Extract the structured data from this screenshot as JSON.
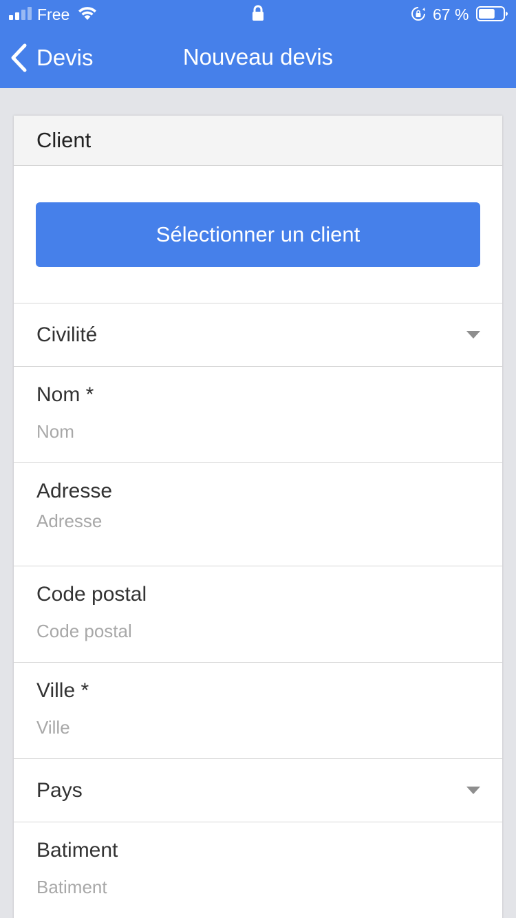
{
  "status_bar": {
    "carrier": "Free",
    "battery_percent": "67 %",
    "battery_level": 0.67,
    "icons": [
      "signal-icon",
      "wifi-icon",
      "lock-icon",
      "rotation-lock-icon",
      "battery-icon"
    ]
  },
  "nav": {
    "back_label": "Devis",
    "title": "Nouveau devis",
    "back_icon": "chevron-left-icon"
  },
  "colors": {
    "accent": "#4680ea",
    "background": "#e3e4e8",
    "placeholder": "#a8a8a8"
  },
  "card": {
    "header": "Client",
    "select_client_label": "Sélectionner un client",
    "fields": {
      "civilite": {
        "label": "Civilité",
        "icon": "dropdown-caret-icon"
      },
      "nom": {
        "label": "Nom *",
        "placeholder": "Nom",
        "value": ""
      },
      "adresse": {
        "label": "Adresse",
        "placeholder": "Adresse",
        "value": ""
      },
      "code_postal": {
        "label": "Code postal",
        "placeholder": "Code postal",
        "value": ""
      },
      "ville": {
        "label": "Ville *",
        "placeholder": "Ville",
        "value": ""
      },
      "pays": {
        "label": "Pays",
        "icon": "dropdown-caret-icon"
      },
      "batiment": {
        "label": "Batiment",
        "placeholder": "Batiment",
        "value": ""
      }
    }
  }
}
